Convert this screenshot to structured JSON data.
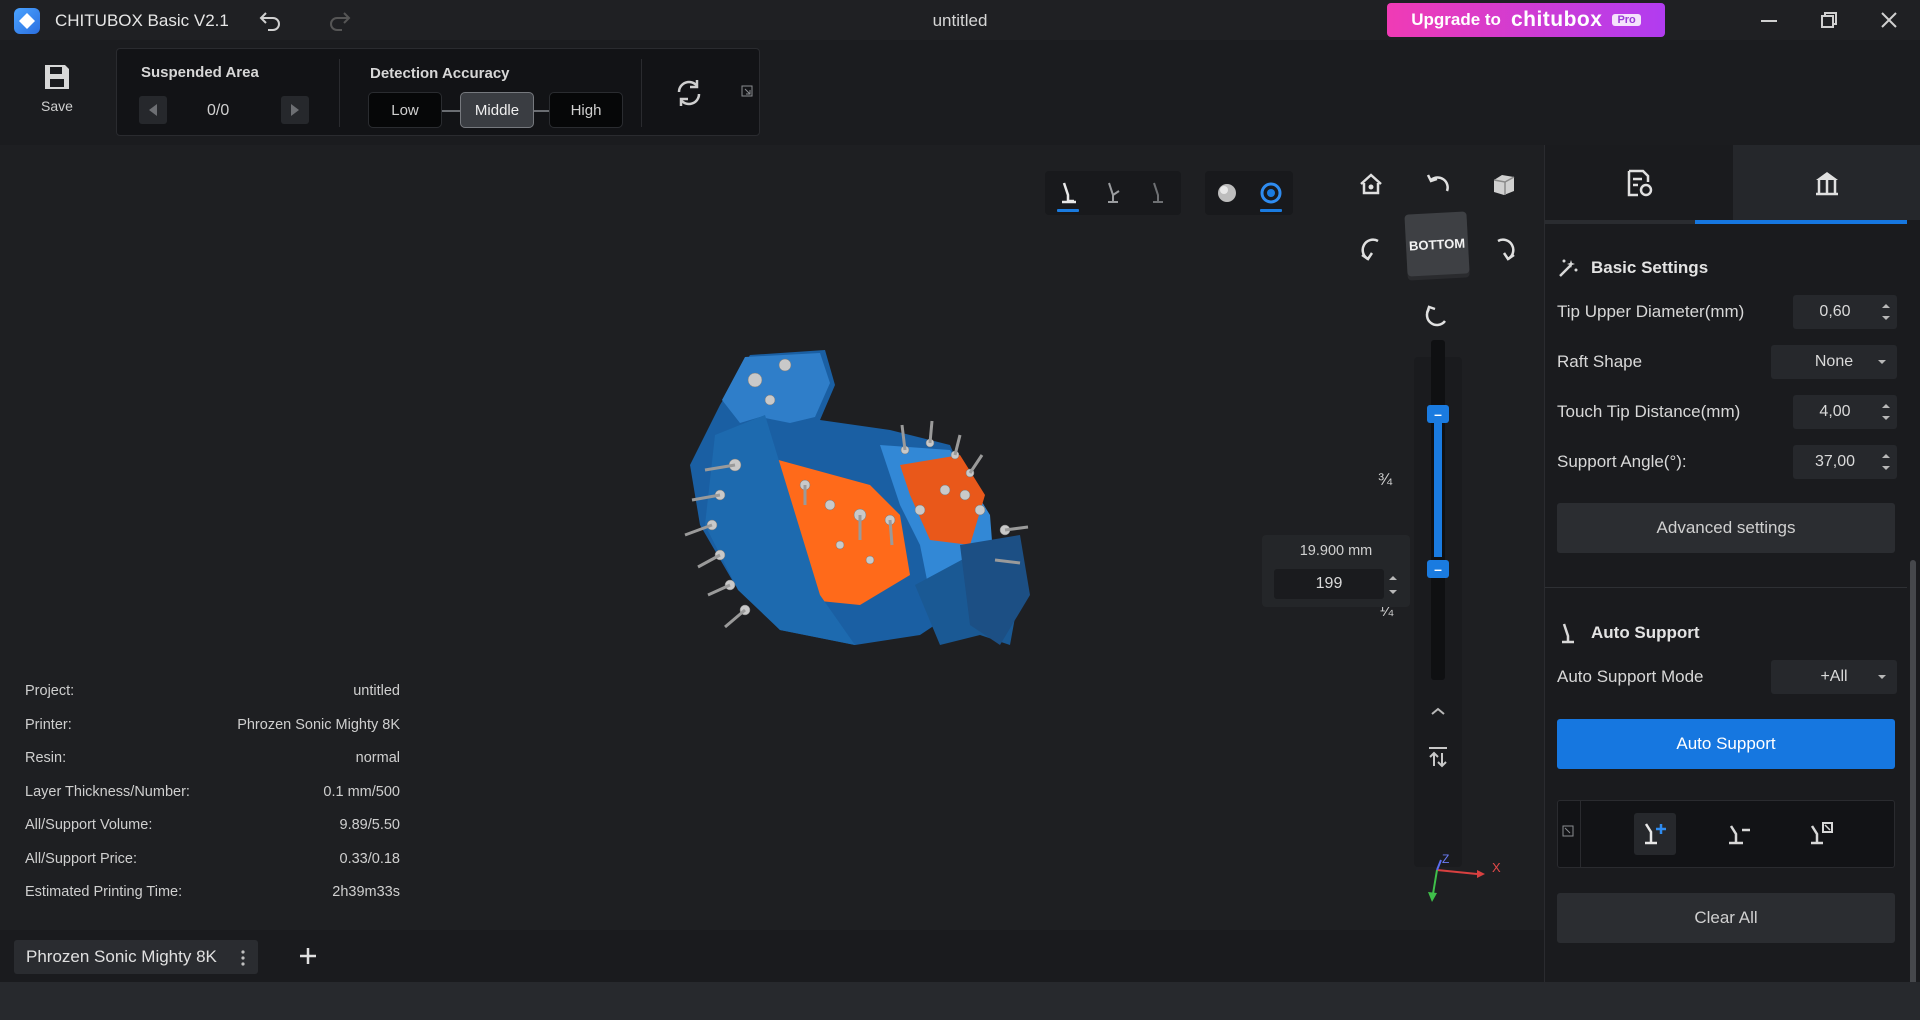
{
  "app": {
    "title": "CHITUBOX Basic V2.1",
    "document_title": "untitled",
    "upgrade_label": "Upgrade to",
    "upgrade_brand": "chitubox",
    "upgrade_badge": "Pro"
  },
  "toolbar": {
    "save_label": "Save",
    "suspended_area": {
      "title": "Suspended Area",
      "value": "0/0"
    },
    "detection_accuracy": {
      "title": "Detection Accuracy",
      "options": [
        "Low",
        "Middle",
        "High"
      ],
      "selected": "Middle"
    }
  },
  "viewport": {
    "view_cube_label": "BOTTOM",
    "slider": {
      "mark_upper": "¾",
      "mark_lower": "¼",
      "height_readout": "19.900 mm",
      "layer_value": "199"
    },
    "axes": {
      "x": "X",
      "y": "Y",
      "z": "Z"
    },
    "project_info": [
      {
        "label": "Project:",
        "value": "untitled"
      },
      {
        "label": "Printer:",
        "value": "Phrozen Sonic Mighty 8K"
      },
      {
        "label": "Resin:",
        "value": "normal"
      },
      {
        "label": "Layer Thickness/Number:",
        "value": "0.1 mm/500"
      },
      {
        "label": "All/Support Volume:",
        "value": "9.89/5.50"
      },
      {
        "label": "All/Support Price:",
        "value": "0.33/0.18"
      },
      {
        "label": "Estimated Printing Time:",
        "value": "2h39m33s"
      }
    ]
  },
  "right_panel": {
    "basic_settings": {
      "title": "Basic Settings",
      "tip_upper_diameter": {
        "label": "Tip Upper Diameter(mm)",
        "value": "0,60"
      },
      "raft_shape": {
        "label": "Raft Shape",
        "value": "None"
      },
      "touch_tip_distance": {
        "label": "Touch Tip Distance(mm)",
        "value": "4,00"
      },
      "support_angle": {
        "label": "Support Angle(°):",
        "value": "37,00"
      },
      "advanced_label": "Advanced settings"
    },
    "auto_support": {
      "title": "Auto Support",
      "mode_label": "Auto Support Mode",
      "mode_value": "+All",
      "button_label": "Auto Support",
      "clear_label": "Clear All"
    }
  },
  "bottom_bar": {
    "printer_tab": "Phrozen Sonic Mighty 8K"
  },
  "colors": {
    "accent": "#1677e0",
    "model_blue": "#1f6fb5",
    "model_orange": "#ff6a1a",
    "upgrade_gradient_start": "#f03bb5",
    "upgrade_gradient_end": "#b13cf0"
  }
}
